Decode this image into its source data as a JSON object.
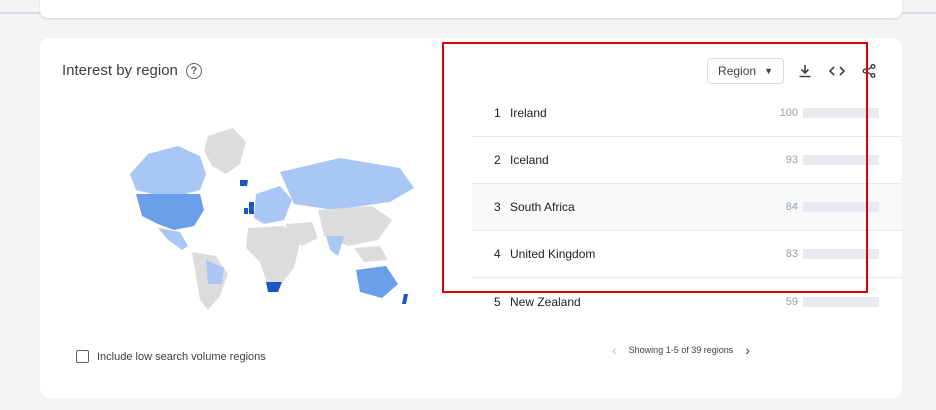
{
  "card": {
    "title": "Interest by region",
    "region_select": "Region",
    "include_low_volume": "Include low search volume regions",
    "pager_text": "Showing 1-5 of 39 regions",
    "rows": [
      {
        "rank": "1",
        "name": "Ireland",
        "value": "100",
        "level": 1.0
      },
      {
        "rank": "2",
        "name": "Iceland",
        "value": "93",
        "level": 0.93
      },
      {
        "rank": "3",
        "name": "South Africa",
        "value": "84",
        "level": 0.84
      },
      {
        "rank": "4",
        "name": "United Kingdom",
        "value": "83",
        "level": 0.83
      },
      {
        "rank": "5",
        "name": "New Zealand",
        "value": "59",
        "level": 0.59
      }
    ]
  },
  "colors": {
    "bar": "#4285f4",
    "highlight": "#e00000",
    "map_dark": "#1a56c4",
    "map_mid": "#6a9ee8",
    "map_light": "#a9c7f5",
    "map_gray": "#dcdcdc"
  },
  "icons": {
    "help": "help-icon",
    "download": "download-icon",
    "embed": "embed-icon",
    "share": "share-icon",
    "prev": "chevron-left-icon",
    "next": "chevron-right-icon"
  }
}
